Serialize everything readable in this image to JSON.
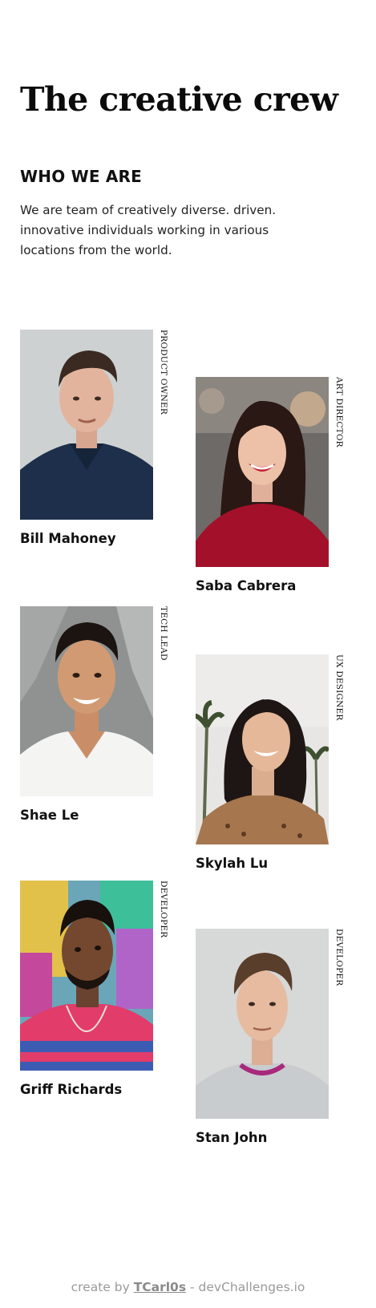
{
  "header": {
    "title": "The creative crew",
    "subtitle": "WHO WE ARE",
    "description": "We are team of creatively diverse. driven. innovative individuals working in various locations from the world."
  },
  "team": [
    {
      "name": "Bill Mahoney",
      "role": "PRODUCT OWNER"
    },
    {
      "name": "Saba Cabrera",
      "role": "ART DIRECTOR"
    },
    {
      "name": "Shae Le",
      "role": "TECH LEAD"
    },
    {
      "name": "Skylah Lu",
      "role": "UX DESIGNER"
    },
    {
      "name": "Griff Richards",
      "role": "DEVELOPER"
    },
    {
      "name": "Stan John",
      "role": "DEVELOPER"
    }
  ],
  "footer": {
    "prefix": "create by",
    "author": "TCarl0s",
    "suffix": "- devChallenges.io"
  },
  "colors": {
    "text": "#111111",
    "footer_text": "#9a9a9a"
  }
}
